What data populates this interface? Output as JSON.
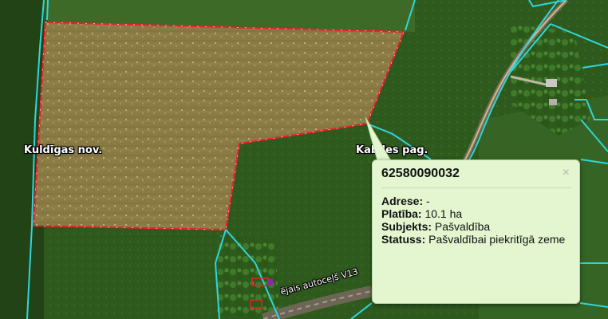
{
  "map": {
    "labels": {
      "kuldiga": "Kuldīgas nov.",
      "kabile": "Kabiles pag.",
      "road": "ējais autoceļš V13"
    },
    "colors": {
      "parcel_outline": "#e8202a",
      "cadastre_lines": "#2fd6dc",
      "field_fill": "#8a7b45",
      "vegetation": "#2f5a1e"
    }
  },
  "popup": {
    "title": "62580090032",
    "close": "×",
    "fields": [
      {
        "key": "Adrese:",
        "value": "-"
      },
      {
        "key": "Platība:",
        "value": "10.1 ha"
      },
      {
        "key": "Subjekts:",
        "value": "Pašvaldība"
      },
      {
        "key": "Statuss:",
        "value": "Pašvaldībai piekritīgā zeme"
      }
    ]
  }
}
